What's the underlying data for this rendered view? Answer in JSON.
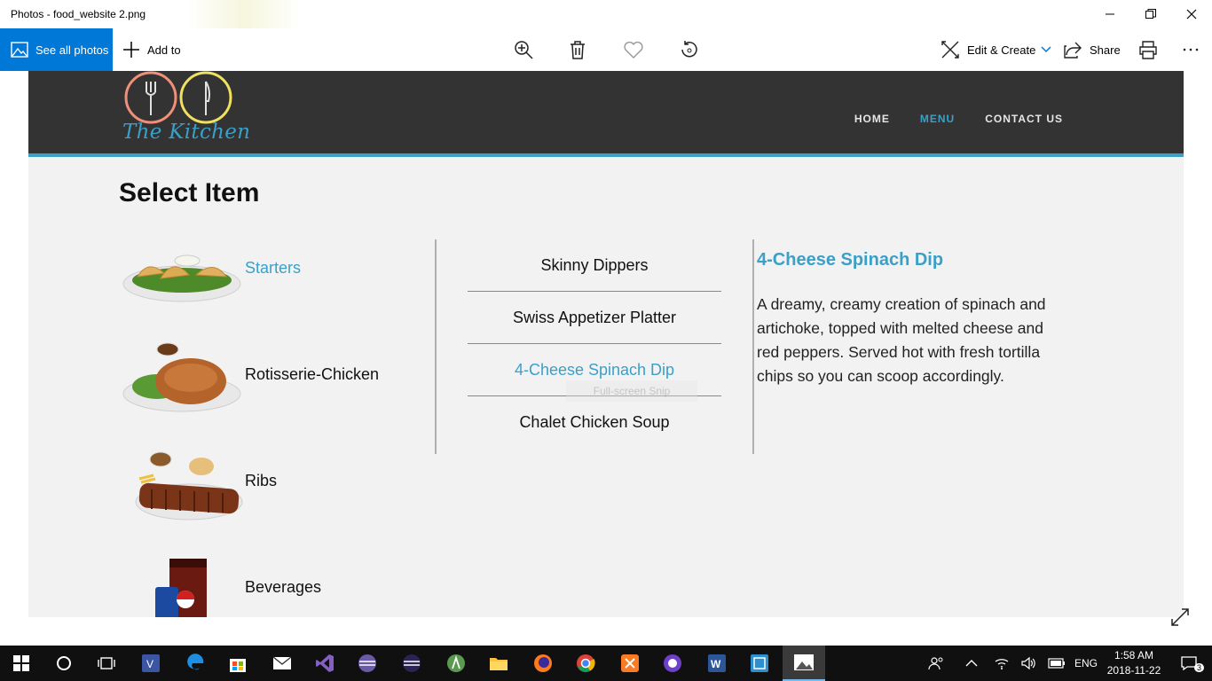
{
  "window": {
    "title": "Photos - food_website 2.png"
  },
  "toolbar": {
    "see_all": "See all photos",
    "add_to": "Add to",
    "edit_create": "Edit & Create",
    "share": "Share"
  },
  "site": {
    "logo_text": "The Kitchen",
    "nav": [
      "HOME",
      "MENU",
      "CONTACT US"
    ],
    "active_nav": "MENU",
    "page_title": "Select Item",
    "categories": [
      "Starters",
      "Rotisserie-Chicken",
      "Ribs",
      "Beverages"
    ],
    "active_category": "Starters",
    "items": [
      "Skinny Dippers",
      "Swiss Appetizer Platter",
      "4-Cheese Spinach Dip",
      "Chalet Chicken Soup"
    ],
    "active_item": "4-Cheese Spinach Dip",
    "ghost_tooltip": "Full-screen Snip",
    "detail": {
      "title": "4-Cheese Spinach Dip",
      "description": "A dreamy, creamy creation of spinach and artichoke, topped with melted cheese and red peppers. Served hot with fresh tortilla chips so you can scoop accordingly."
    },
    "colors": {
      "accent": "#3aa0c8",
      "header_bg": "#333333",
      "page_bg": "#f2f2f2"
    }
  },
  "taskbar": {
    "language": "ENG",
    "time": "1:58 AM",
    "date": "2018-11-22",
    "notifications": "3"
  }
}
